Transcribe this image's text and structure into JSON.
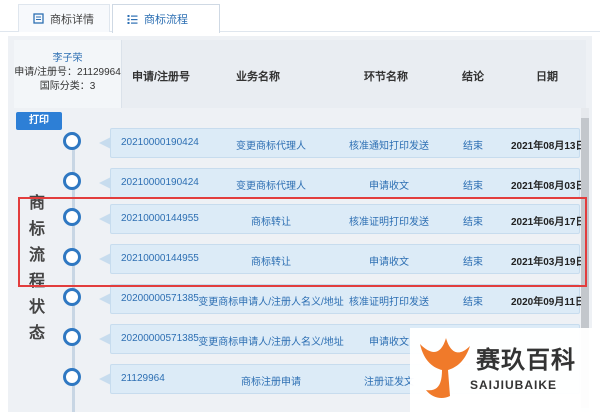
{
  "tabs": [
    {
      "label": "商标详情",
      "icon": "document-icon"
    },
    {
      "label": "商标流程",
      "icon": "list-icon"
    }
  ],
  "header": {
    "user_name": "李子荣",
    "reg_no": "申请/注册号：21129964",
    "intl_class": "国际分类：3",
    "columns": [
      "申请/注册号",
      "业务名称",
      "环节名称",
      "结论",
      "日期"
    ]
  },
  "print_label": "打印",
  "side_title": "商标流程状态",
  "rows": [
    {
      "no": "20210000190424",
      "business": "变更商标代理人",
      "step": "核准通知打印发送",
      "result": "结束",
      "date": "2021年08月13日"
    },
    {
      "no": "20210000190424",
      "business": "变更商标代理人",
      "step": "申请收文",
      "result": "结束",
      "date": "2021年08月03日"
    },
    {
      "no": "20210000144955",
      "business": "商标转让",
      "step": "核准证明打印发送",
      "result": "结束",
      "date": "2021年06月17日"
    },
    {
      "no": "20210000144955",
      "business": "商标转让",
      "step": "申请收文",
      "result": "结束",
      "date": "2021年03月19日"
    },
    {
      "no": "20200000571385",
      "business": "变更商标申请人/注册人名义/地址",
      "step": "核准证明打印发送",
      "result": "结束",
      "date": "2020年09月11日"
    },
    {
      "no": "20200000571385",
      "business": "变更商标申请人/注册人名义/地址",
      "step": "申请收文",
      "result": "",
      "date": ""
    },
    {
      "no": "21129964",
      "business": "商标注册申请",
      "step": "注册证发文",
      "result": "",
      "date": ""
    }
  ],
  "watermark": {
    "title": "赛玖百科",
    "subtitle": "SAIJIUBAIKE"
  },
  "colors": {
    "accent": "#2d7fd6",
    "node": "#2f78c2",
    "highlight": "#e23d3d",
    "row_bg": "#dcebf7"
  }
}
